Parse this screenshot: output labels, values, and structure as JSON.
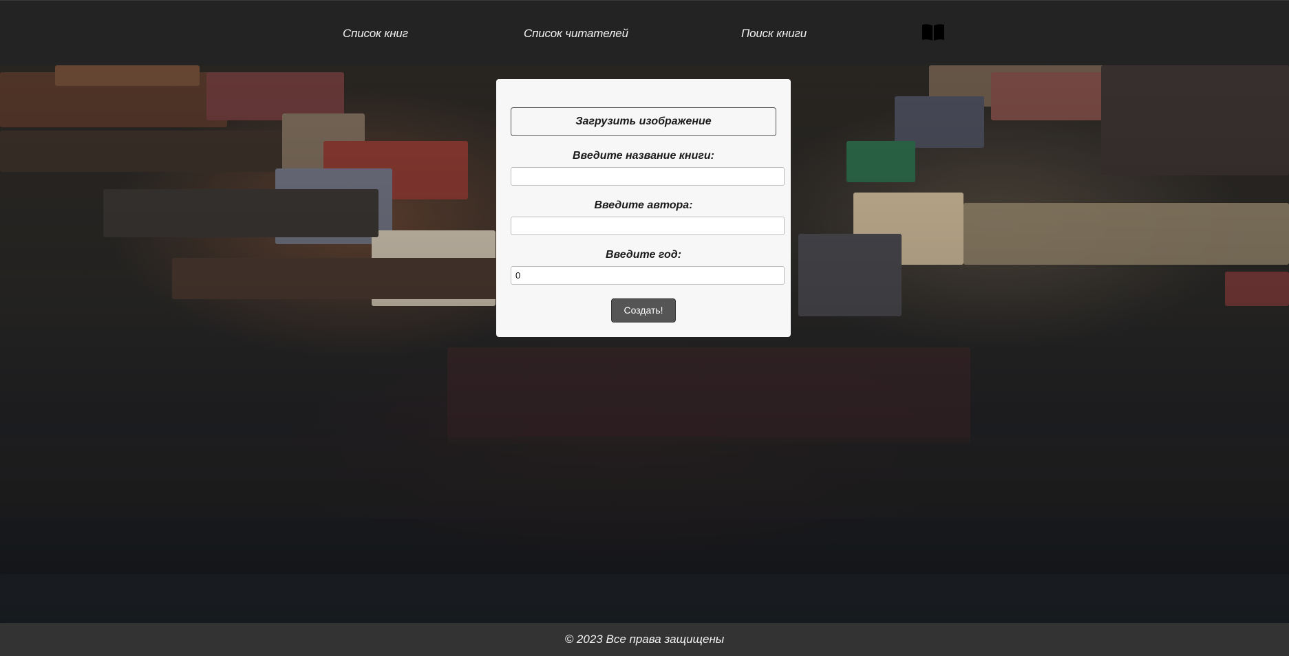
{
  "nav": {
    "books_list": "Список книг",
    "readers_list": "Список читателей",
    "book_search": "Поиск книги",
    "logo_icon": "open-book-icon"
  },
  "form": {
    "upload_label": "Загрузить изображение",
    "title_label": "Введите название книги:",
    "title_value": "",
    "author_label": "Введите автора:",
    "author_value": "",
    "year_label": "Введите год:",
    "year_value": "0",
    "submit_label": "Создать!"
  },
  "footer": {
    "copyright": "© 2023 Все права защищены"
  },
  "colors": {
    "header_bg": "#232323",
    "footer_bg": "#333333",
    "card_bg": "#f7f7f7",
    "submit_bg": "#555555"
  }
}
